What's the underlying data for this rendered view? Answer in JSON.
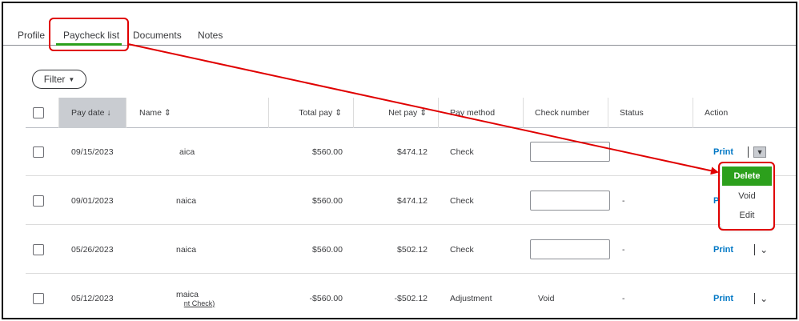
{
  "tabs": [
    {
      "label": "Profile"
    },
    {
      "label": "Paycheck list"
    },
    {
      "label": "Documents"
    },
    {
      "label": "Notes"
    }
  ],
  "filter": {
    "label": "Filter"
  },
  "columns": {
    "pay_date": "Pay date ↓",
    "name": "Name ⇕",
    "total_pay": "Total pay ⇕",
    "net_pay": "Net pay ⇕",
    "pay_method": "Pay method",
    "check_number": "Check number",
    "status": "Status",
    "action": "Action"
  },
  "rows": [
    {
      "pay_date": "09/15/2023",
      "name": "aica",
      "name_sub": "",
      "total_pay": "$560.00",
      "net_pay": "$474.12",
      "pay_method": "Check",
      "check_number": "",
      "status": "",
      "action": "Print"
    },
    {
      "pay_date": "09/01/2023",
      "name": "naica",
      "name_sub": "",
      "total_pay": "$560.00",
      "net_pay": "$474.12",
      "pay_method": "Check",
      "check_number": "",
      "status": "-",
      "action": "P"
    },
    {
      "pay_date": "05/26/2023",
      "name": "naica",
      "name_sub": "",
      "total_pay": "$560.00",
      "net_pay": "$502.12",
      "pay_method": "Check",
      "check_number": "",
      "status": "-",
      "action": "Print"
    },
    {
      "pay_date": "05/12/2023",
      "name": "maica",
      "name_sub": "nt Check)",
      "total_pay": "-$560.00",
      "net_pay": "-$502.12",
      "pay_method": "Adjustment",
      "check_number": "Void",
      "status": "-",
      "action": "Print"
    }
  ],
  "action_menu": {
    "items": [
      "Delete",
      "Void",
      "Edit"
    ]
  },
  "colors": {
    "accent_green": "#2ca01c",
    "link_blue": "#0077c5",
    "annotation_red": "#e00000"
  }
}
